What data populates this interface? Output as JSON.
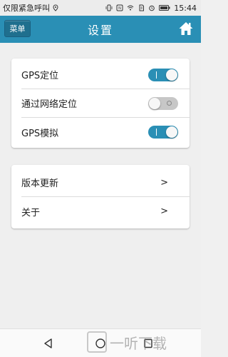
{
  "status_bar": {
    "carrier_text": "仅限紧急呼叫",
    "time": "15:44",
    "icons": [
      "location-icon",
      "vibrate-icon",
      "nfc-icon",
      "wifi-icon",
      "sim-icon",
      "alarm-icon",
      "battery-icon"
    ]
  },
  "header": {
    "menu_label": "菜单",
    "title": "设置",
    "home_icon": "home-icon",
    "color": "#2a8fb5"
  },
  "settings": {
    "toggles": [
      {
        "label": "GPS定位",
        "state": "on"
      },
      {
        "label": "通过网络定位",
        "state": "off"
      },
      {
        "label": "GPS模拟",
        "state": "on"
      }
    ],
    "links": [
      {
        "label": "版本更新",
        "chevron": ">"
      },
      {
        "label": "关于",
        "chevron": ">"
      }
    ]
  },
  "navbar": {
    "icons": [
      "back-icon",
      "home-circle-icon",
      "recents-icon"
    ]
  },
  "watermark": {
    "text": "一听下载"
  }
}
